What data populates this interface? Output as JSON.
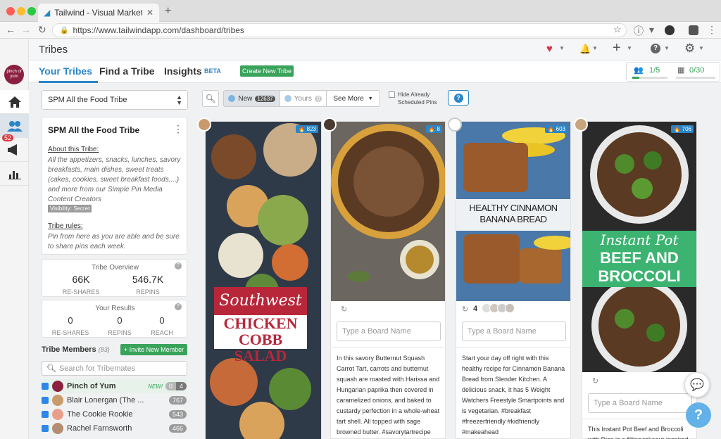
{
  "browser": {
    "tab_title": "Tailwind - Visual Marketing Su",
    "url": "https://www.tailwindapp.com/dashboard/tribes"
  },
  "header": {
    "title": "Tribes"
  },
  "sidebar": {
    "avatar_text": "pinch of yum",
    "notif_count": "52"
  },
  "nav": {
    "your_tribes": "Your Tribes",
    "find_tribe": "Find a Tribe",
    "insights": "Insights",
    "beta": "BETA",
    "create": "Create New Tribe",
    "members_ratio": "1/5",
    "pins_ratio": "0/30"
  },
  "tribe_select": "SPM All the Food Tribe",
  "about": {
    "name": "SPM All the Food Tribe",
    "about_heading": "About this Tribe:",
    "description": "All the appetizers, snacks, lunches, savory breakfasts, main dishes, sweet treats (cakes, cookies, sweet breakfast foods,...) and more from our Simple Pin Media Content Creators",
    "visibility": "Visibility: Secret",
    "rules_heading": "Tribe rules:",
    "rules": "Pin from here as you are able and be sure to share pins each week."
  },
  "overview": {
    "title": "Tribe Overview",
    "reshares": "66K",
    "reshares_label": "RE-SHARES",
    "repins": "546.7K",
    "repins_label": "REPINS"
  },
  "results": {
    "title": "Your Results",
    "reshares": "0",
    "reshares_label": "RE-SHARES",
    "repins": "0",
    "repins_label": "REPINS",
    "reach": "0",
    "reach_label": "REACH"
  },
  "members": {
    "title": "Tribe Members",
    "count": "(83)",
    "invite": "+ Invite New Member",
    "search_placeholder": "Search for Tribemates",
    "list": [
      {
        "name": "Pinch of Yum",
        "new": "NEW!",
        "a": "0",
        "b": "4"
      },
      {
        "name": "Blair Lonergan (The ...",
        "badge": "767"
      },
      {
        "name": "The Cookie Rookie",
        "badge": "543"
      },
      {
        "name": "Rachel Farnsworth",
        "badge": "466"
      }
    ]
  },
  "filters": {
    "new": "New",
    "new_count": "12637",
    "yours": "Yours",
    "yours_count": "0",
    "see_more": "See More",
    "hide_line1": "Hide Already",
    "hide_line2": "Scheduled Pins",
    "help": "?"
  },
  "pins": [
    {
      "count": "823",
      "title1": "Southwest",
      "title2": "CHICKEN",
      "title3": "COBB SALAD"
    },
    {
      "count": "8",
      "board_placeholder": "Type a Board Name",
      "desc": "In this savory Butternut Squash Carrot Tart, carrots and butternut squash are roasted with Harissa and Hungarian paprika then covered in caramelized onions, and baked to custardy perfection in a whole-wheat tart shell. All topped with sage browned butter. #savorytartrecipe #squashcarrottart"
    },
    {
      "count": "603",
      "title1": "HEALTHY CINNAMON",
      "title2": "BANANA BREAD",
      "repins": "4",
      "board_placeholder": "Type a Board Name",
      "desc": "Start your day off right with this healthy recipe for Cinnamon Banana Bread from Slender Kitchen. A delicious snack, it has 5 Weight Watchers Freestyle Smartpoints and is vegetarian. #breakfast #freezerfriendly #kidfriendly #makeahead"
    },
    {
      "count": "706",
      "title1": "Instant Pot",
      "title2": "BEEF AND",
      "title3": "BROCCOLI",
      "board_placeholder": "Type a Board Name",
      "desc": "This Instant Pot Beef and Broccoli with Rice is a filling takeout-inspired"
    }
  ],
  "colors": {
    "accent": "#2a86c8",
    "green": "#3cb371",
    "red": "#b8263a"
  }
}
